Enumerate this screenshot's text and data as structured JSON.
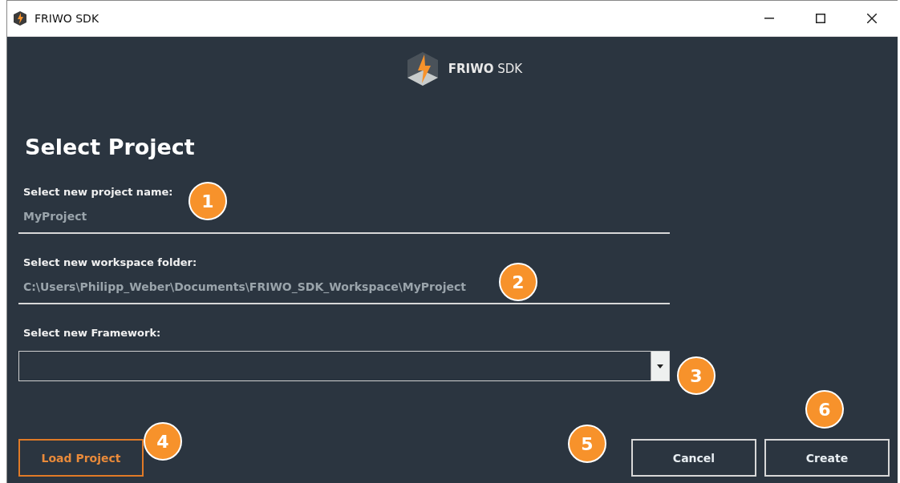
{
  "window": {
    "title": "FRIWO SDK"
  },
  "header": {
    "brand_bold": "FRIWO",
    "brand_light": "SDK"
  },
  "heading": "Select Project",
  "fields": [
    {
      "kind": "text",
      "label": "Select new project name:",
      "value": "MyProject"
    },
    {
      "kind": "text",
      "label": "Select new workspace folder:",
      "value": "C:\\Users\\Philipp_Weber\\Documents\\FRIWO_SDK_Workspace\\MyProject"
    },
    {
      "kind": "dropdown",
      "label": "Select new Framework:"
    }
  ],
  "buttons": [
    {
      "label": "Load Project",
      "kind": "accent"
    },
    {
      "label": "Cancel",
      "kind": "plain"
    },
    {
      "label": "Create",
      "kind": "plain"
    }
  ],
  "callouts": [
    "1",
    "2",
    "3",
    "4",
    "5",
    "6"
  ]
}
